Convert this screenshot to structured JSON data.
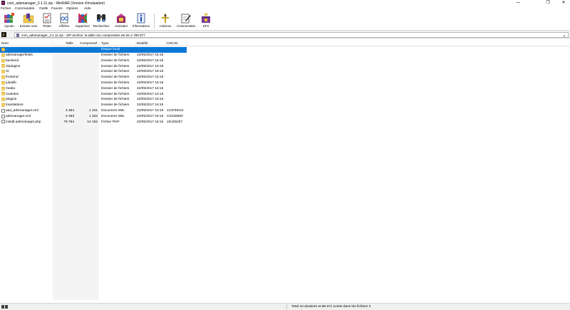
{
  "window": {
    "title": "com_adsmanager_3.1.11.zip - WinRAR (Version d'évaluation)",
    "minimize_glyph": "—",
    "maximize_glyph": "❐",
    "close_glyph": "✕"
  },
  "menu": {
    "items": [
      "Fichier",
      "Commandes",
      "Outils",
      "Favoris",
      "Options",
      "Aide"
    ]
  },
  "toolbar": {
    "buttons": [
      {
        "label": "Ajouter",
        "icon": "add-books-icon"
      },
      {
        "label": "Extraire vers",
        "icon": "extract-folder-icon"
      },
      {
        "label": "Tester",
        "icon": "test-checklist-icon"
      },
      {
        "label": "Afficher",
        "icon": "view-glasses-icon"
      },
      {
        "label": "Supprimer",
        "icon": "delete-books-icon"
      },
      {
        "label": "Rechercher",
        "icon": "binoculars-icon"
      },
      {
        "label": "Assistant",
        "icon": "wizard-icon"
      },
      {
        "label": "Informations",
        "icon": "info-icon"
      },
      {
        "label": "Antivirus",
        "icon": "antivirus-icon"
      },
      {
        "label": "Commentaire",
        "icon": "comment-pen-icon"
      },
      {
        "label": "SFX",
        "icon": "sfx-box-icon"
      }
    ]
  },
  "path": {
    "text": "com_adsmanager_3.1.11.zip - ZIP archive, la taille non compressée est de 4 789 877"
  },
  "columns": {
    "name": "Nom",
    "size": "Taille",
    "packed": "Compressé",
    "type": "Type",
    "modified": "Modifié",
    "crc": "CRC32"
  },
  "files": [
    {
      "name": "..",
      "size": "",
      "packed": "",
      "type": "Disque local",
      "modified": "",
      "crc": "",
      "kind": "parent",
      "selected": true
    },
    {
      "name": "adsmanagerfields",
      "size": "",
      "packed": "",
      "type": "Dossier de fichiers",
      "modified": "22/05/2017 16:15",
      "crc": "",
      "kind": "folder"
    },
    {
      "name": "backend",
      "size": "",
      "packed": "",
      "type": "Dossier de fichiers",
      "modified": "22/05/2017 16:15",
      "crc": "",
      "kind": "folder"
    },
    {
      "name": "cbplugins",
      "size": "",
      "packed": "",
      "type": "Dossier de fichiers",
      "modified": "22/05/2017 16:15",
      "crc": "",
      "kind": "folder"
    },
    {
      "name": "cli",
      "size": "",
      "packed": "",
      "type": "Dossier de fichiers",
      "modified": "22/05/2017 16:15",
      "crc": "",
      "kind": "folder"
    },
    {
      "name": "frontend",
      "size": "",
      "packed": "",
      "type": "Dossier de fichiers",
      "modified": "22/05/2017 16:15",
      "crc": "",
      "kind": "folder"
    },
    {
      "name": "juloalib",
      "size": "",
      "packed": "",
      "type": "Dossier de fichiers",
      "modified": "22/05/2017 16:15",
      "crc": "",
      "kind": "folder"
    },
    {
      "name": "media",
      "size": "",
      "packed": "",
      "type": "Dossier de fichiers",
      "modified": "22/05/2017 16:15",
      "crc": "",
      "kind": "folder"
    },
    {
      "name": "modules",
      "size": "",
      "packed": "",
      "type": "Dossier de fichiers",
      "modified": "22/05/2017 16:15",
      "crc": "",
      "kind": "folder"
    },
    {
      "name": "plugins",
      "size": "",
      "packed": "",
      "type": "Dossier de fichiers",
      "modified": "22/05/2017 16:15",
      "crc": "",
      "kind": "folder"
    },
    {
      "name": "translations",
      "size": "",
      "packed": "",
      "type": "Dossier de fichiers",
      "modified": "22/05/2017 16:15",
      "crc": "",
      "kind": "folder"
    },
    {
      "name": "aaa_adsmanager.xml",
      "size": "4 484",
      "packed": "1 101",
      "type": "Document XML",
      "modified": "22/05/2017 16:15",
      "crc": "1C97ED44",
      "kind": "file"
    },
    {
      "name": "adsmanager.xml",
      "size": "4 483",
      "packed": "1 152",
      "type": "Document XML",
      "modified": "22/05/2017 16:15",
      "crc": "CD108600",
      "kind": "file"
    },
    {
      "name": "install.adsmanager.php",
      "size": "79 784",
      "packed": "14 192",
      "type": "Fichier PHP",
      "modified": "22/05/2017 16:15",
      "crc": "1D185257",
      "kind": "file"
    }
  ],
  "status": {
    "text": "Total 10 dossiers et 88 671 octets dans les fichiers 3"
  }
}
